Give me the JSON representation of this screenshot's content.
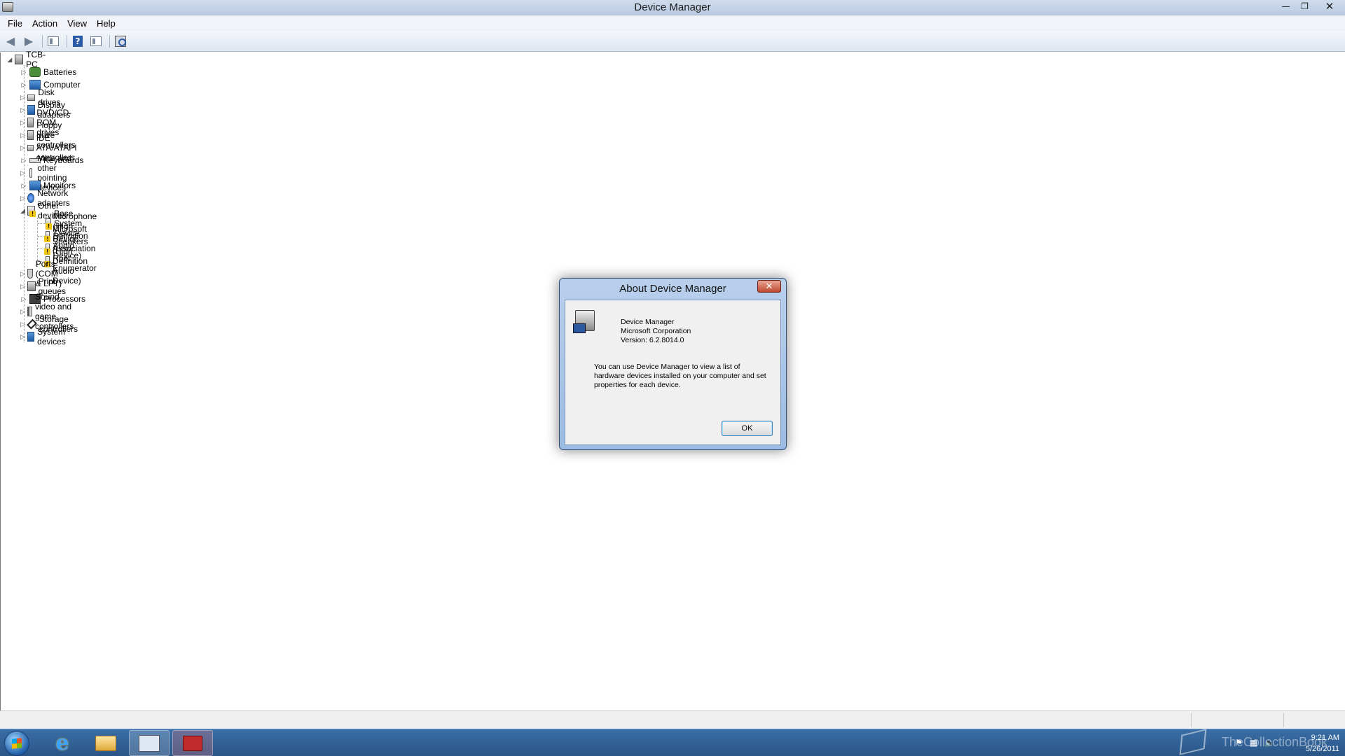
{
  "window": {
    "title": "Device Manager",
    "minimize": "—",
    "maximize": "❐",
    "close": "✕"
  },
  "menu": [
    "File",
    "Action",
    "View",
    "Help"
  ],
  "toolbar": {
    "back": "◀",
    "forward": "▶",
    "help": "?"
  },
  "tree": {
    "root": "TCB-PC",
    "categories": [
      "Batteries",
      "Computer",
      "Disk drives",
      "Display adapters",
      "DVD/CD-ROM drives",
      "Floppy drive controllers",
      "IDE ATA/ATAPI controllers",
      "Keyboards",
      "Mice and other pointing devices",
      "Monitors",
      "Network adapters",
      "Other devices"
    ],
    "other_devices": [
      "Base System Device",
      "Microphone (High Definition Audio Device)",
      "Microsoft Device Association Root Enumerator",
      "Speakers (High Definition Audio Device)"
    ],
    "categories_after": [
      "Ports (COM & LPT)",
      "Print queues",
      "Processors",
      "Sound, video and game controllers",
      "Storage controllers",
      "System devices"
    ]
  },
  "dialog": {
    "title": "About Device Manager",
    "close": "✕",
    "name": "Device Manager",
    "company": "Microsoft Corporation",
    "version": "Version: 6.2.8014.0",
    "description": "You can use Device Manager to view a list of hardware devices installed on your computer and set properties for each device.",
    "ok": "OK"
  },
  "taskbar": {
    "time": "9:21 AM",
    "date": "5/26/2011",
    "watermark": "TheCollectionBook",
    "ie_glyph": "e"
  }
}
